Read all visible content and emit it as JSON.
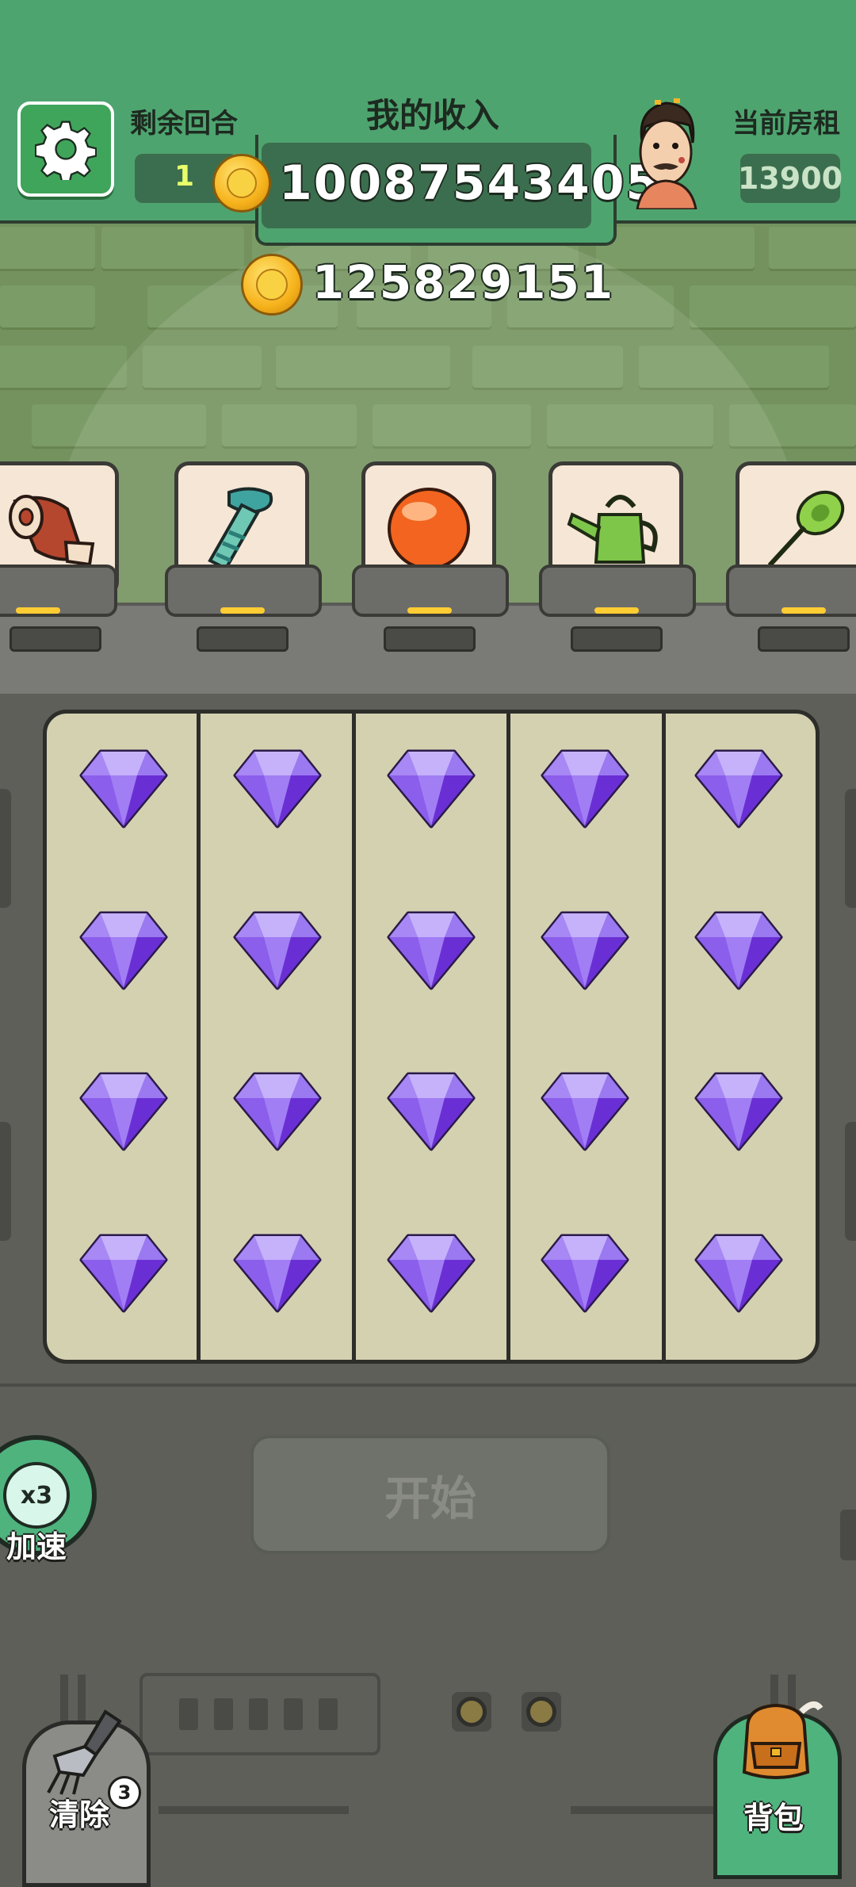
{
  "header": {
    "rounds_label": "剩余回合",
    "rounds_value": "1",
    "income_label": "我的收入",
    "income_value": "10087543405",
    "rent_label": "当前房租",
    "rent_value": "13900"
  },
  "coins": {
    "value": "125829151"
  },
  "items": [
    {
      "name": "meat-roll-icon"
    },
    {
      "name": "necktie-icon"
    },
    {
      "name": "orange-ball-icon"
    },
    {
      "name": "watering-can-icon"
    },
    {
      "name": "thumbtack-icon"
    }
  ],
  "grid": {
    "columns": 5,
    "rows": 4,
    "cell_icon": "purple-gem-icon"
  },
  "controls": {
    "start_label": "开始",
    "speed_badge": "x3",
    "speed_label": "加速",
    "clear_label": "清除",
    "clear_count": "3",
    "bag_label": "背包"
  },
  "colors": {
    "banner": "#4ea46f",
    "wall": "#73925e",
    "gem": "#8a55e8",
    "panel": "#d4d1b1"
  }
}
